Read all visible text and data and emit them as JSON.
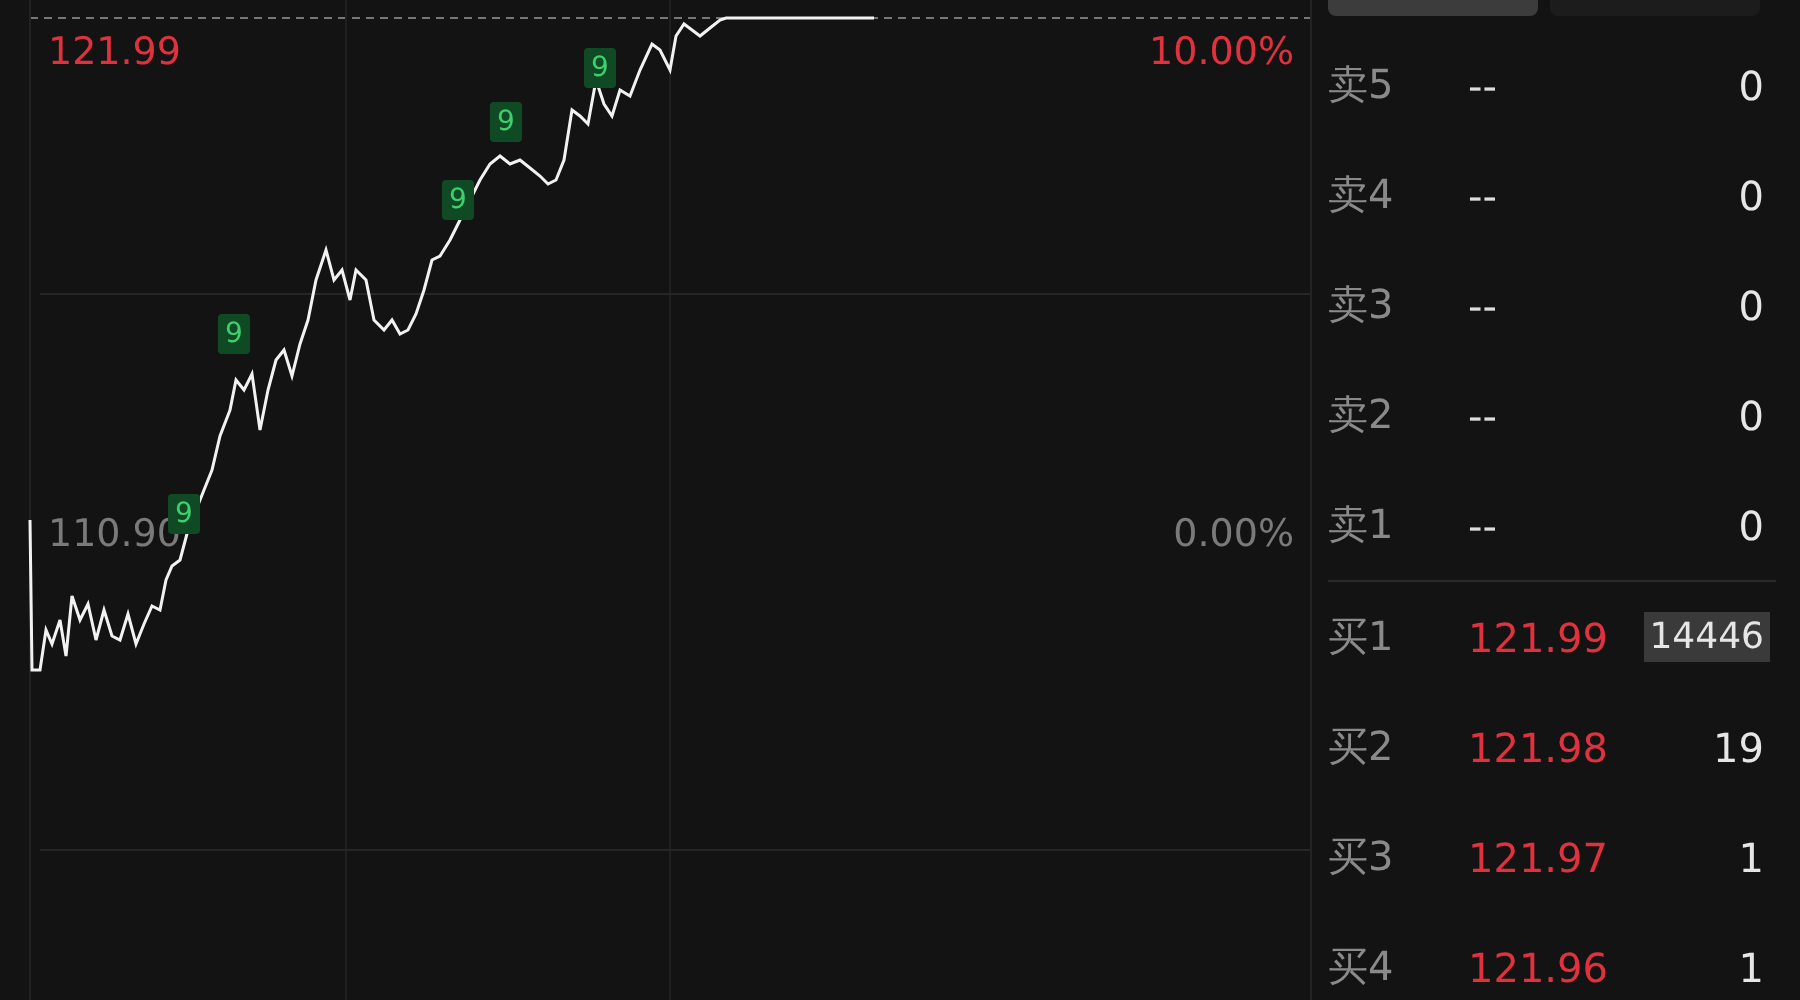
{
  "chart": {
    "top_price": "121.99",
    "top_percent": "10.00%",
    "base_price": "110.90",
    "base_percent": "0.00%",
    "markers": [
      {
        "text": "9"
      },
      {
        "text": "9"
      },
      {
        "text": "9"
      },
      {
        "text": "9"
      },
      {
        "text": "9"
      }
    ]
  },
  "tabs": [
    {
      "selected": true
    },
    {
      "selected": false
    }
  ],
  "order_book": [
    {
      "kind": "sell",
      "label": "卖5",
      "price": "--",
      "volume": "0",
      "highlighted": false
    },
    {
      "kind": "sell",
      "label": "卖4",
      "price": "--",
      "volume": "0",
      "highlighted": false
    },
    {
      "kind": "sell",
      "label": "卖3",
      "price": "--",
      "volume": "0",
      "highlighted": false
    },
    {
      "kind": "sell",
      "label": "卖2",
      "price": "--",
      "volume": "0",
      "highlighted": false
    },
    {
      "kind": "sell",
      "label": "卖1",
      "price": "--",
      "volume": "0",
      "highlighted": false
    },
    {
      "kind": "buy",
      "label": "买1",
      "price": "121.99",
      "volume": "14446",
      "highlighted": true
    },
    {
      "kind": "buy",
      "label": "买2",
      "price": "121.98",
      "volume": "19",
      "highlighted": false
    },
    {
      "kind": "buy",
      "label": "买3",
      "price": "121.97",
      "volume": "1",
      "highlighted": false
    },
    {
      "kind": "buy",
      "label": "买4",
      "price": "121.96",
      "volume": "1",
      "highlighted": false
    }
  ]
}
